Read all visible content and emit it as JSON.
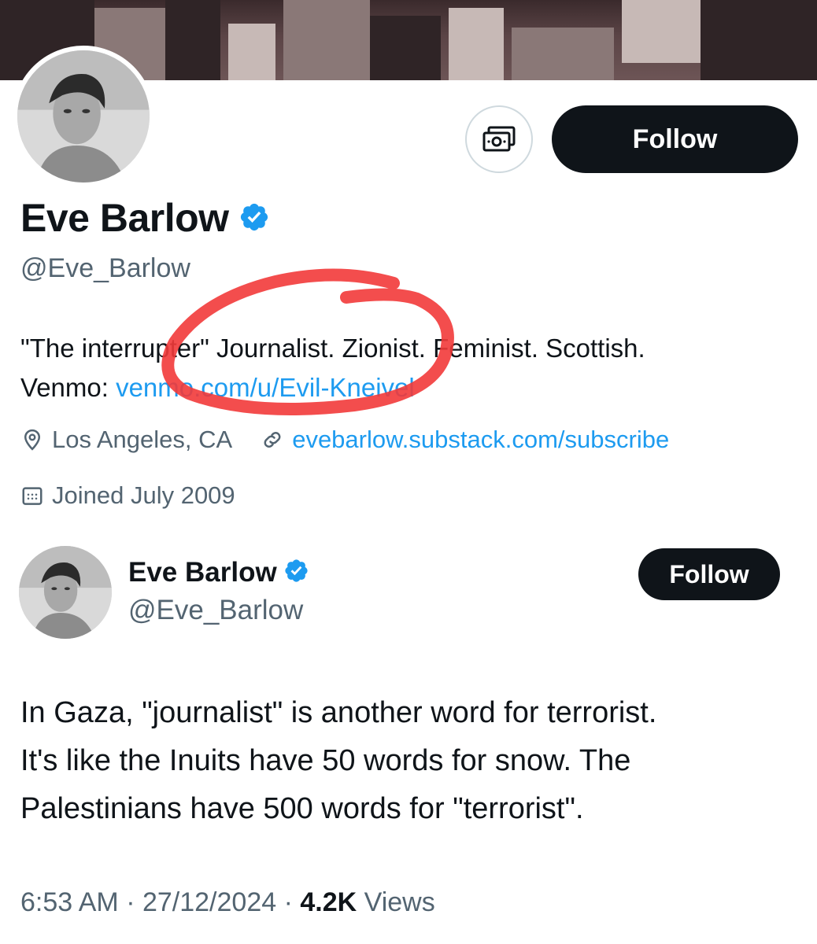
{
  "profile": {
    "name": "Eve Barlow",
    "handle": "@Eve_Barlow",
    "follow_label": "Follow",
    "bio_line1": "\"The interrupter\" Journalist. Zionist. Feminist. Scottish.",
    "bio_line2_prefix": "Venmo: ",
    "bio_link": "venmo.com/u/Evil-Kneivel",
    "location": "Los Angeles, CA",
    "website": "evebarlow.substack.com/subscribe",
    "joined": "Joined July 2009",
    "tip_icon": "money-icon",
    "verified_icon": "verified-badge-icon",
    "annotation_color": "#f23a3a"
  },
  "tweet": {
    "author_name": "Eve Barlow",
    "author_handle": "@Eve_Barlow",
    "follow_label": "Follow",
    "lines": [
      "In Gaza, \"journalist\" is another word for terrorist.",
      "It's like the Inuits have 50 words for snow. The",
      "Palestinians have 500 words for \"terrorist\"."
    ],
    "time": "6:53 AM",
    "sep1": " · ",
    "date": "27/12/2024",
    "sep2": " · ",
    "views_count": "4.2K",
    "views_label": " Views"
  },
  "colors": {
    "link": "#1d9bf0",
    "muted": "#536471",
    "text": "#0f1419",
    "button_bg": "#0f1419"
  }
}
